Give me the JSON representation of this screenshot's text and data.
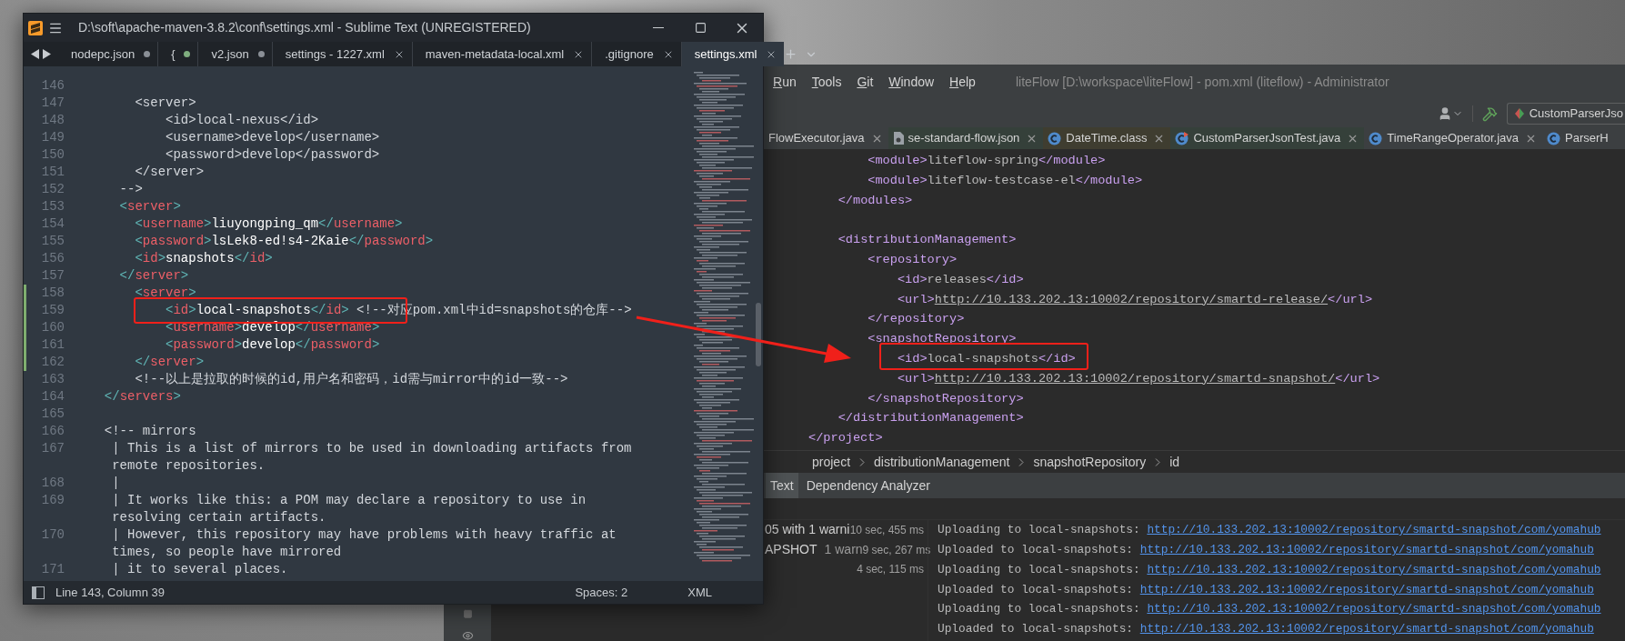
{
  "sublime": {
    "title": "D:\\soft\\apache-maven-3.8.2\\conf\\settings.xml - Sublime Text (UNREGISTERED)",
    "tabs": [
      {
        "label": "nodepc.json",
        "selected": false,
        "modified": true,
        "color": "#8a8f96"
      },
      {
        "label": "{",
        "selected": false,
        "modified": true,
        "color": "#7fae7f"
      },
      {
        "label": "v2.json",
        "selected": false,
        "modified": true,
        "color": "#8a8f96"
      },
      {
        "label": "settings - 1227.xml",
        "selected": false,
        "modified": false
      },
      {
        "label": "maven-metadata-local.xml",
        "selected": false,
        "modified": false
      },
      {
        "label": ".gitignore",
        "selected": false,
        "modified": false
      },
      {
        "label": "settings.xml",
        "selected": true,
        "modified": false
      }
    ],
    "lines": [
      {
        "number": "146",
        "kind": "comment",
        "changed": false
      },
      {
        "number": "147",
        "text": "      <server>",
        "kind": "comment",
        "changed": false
      },
      {
        "number": "148",
        "text": "          <id>local-nexus</id>",
        "kind": "comment",
        "changed": false
      },
      {
        "number": "149",
        "text": "          <username>develop</username>",
        "kind": "comment",
        "changed": false
      },
      {
        "number": "150",
        "text": "          <password>develop</password>",
        "kind": "comment",
        "changed": false
      },
      {
        "number": "151",
        "text": "      </server>",
        "kind": "comment",
        "changed": false
      },
      {
        "number": "152",
        "text": "    -->",
        "kind": "comment",
        "changed": false
      },
      {
        "number": "153",
        "text": "    <server>",
        "kind": "xml",
        "changed": false
      },
      {
        "number": "154",
        "text": "      <username>liuyongping_qm</username>",
        "kind": "xml",
        "changed": false
      },
      {
        "number": "155",
        "text": "      <password>lsLek8-ed!s4-2Kaie</password>",
        "kind": "xml",
        "changed": false
      },
      {
        "number": "156",
        "text": "      <id>snapshots</id>",
        "kind": "xml",
        "changed": false
      },
      {
        "number": "157",
        "text": "    </server>",
        "kind": "xml",
        "changed": false
      },
      {
        "number": "158",
        "text": "      <server>",
        "kind": "xml",
        "changed": true
      },
      {
        "number": "159",
        "text": "          <id>local-snapshots</id>",
        "comment": "<!--对应pom.xml中id=snapshots的仓库-->",
        "kind": "xml",
        "changed": true
      },
      {
        "number": "160",
        "text": "          <username>develop</username>",
        "kind": "xml",
        "changed": true
      },
      {
        "number": "161",
        "text": "          <password>develop</password>",
        "kind": "xml",
        "changed": true
      },
      {
        "number": "162",
        "text": "      </server>",
        "kind": "xml",
        "changed": true
      },
      {
        "number": "163",
        "text": "      <!--以上是拉取的时候的id,用户名和密码，id需与mirror中的id一致-->",
        "kind": "xml",
        "changed": false
      },
      {
        "number": "164",
        "text": "  </servers>",
        "kind": "xml",
        "changed": false
      },
      {
        "number": "165",
        "kind": "comment",
        "changed": false
      },
      {
        "number": "166",
        "text": "  <!-- mirrors",
        "kind": "comment",
        "changed": false
      },
      {
        "number": "167",
        "text": "   | This is a list of mirrors to be used in downloading artifacts from remote repositories.",
        "kind": "comment",
        "changed": false
      },
      {
        "number": "168",
        "text": "   |",
        "kind": "comment",
        "changed": false
      },
      {
        "number": "169",
        "text": "   | It works like this: a POM may declare a repository to use in resolving certain artifacts.",
        "kind": "comment",
        "changed": false
      },
      {
        "number": "170",
        "text": "   | However, this repository may have problems with heavy traffic at times, so people have mirrored",
        "kind": "comment",
        "changed": false
      },
      {
        "number": "171",
        "text": "   | it to several places.",
        "kind": "comment",
        "changed": false
      }
    ],
    "status": {
      "position": "Line 143, Column 39",
      "indentation": "Spaces: 2",
      "syntax": "XML"
    }
  },
  "ide": {
    "menu": [
      "Run",
      "Tools",
      "Git",
      "Window",
      "Help"
    ],
    "title": "liteFlow [D:\\workspace\\liteFlow] - pom.xml (liteflow) - Administrator",
    "run_config": "CustomParserJso",
    "tabs": [
      {
        "label": "FlowExecutor.java",
        "kind": "plain",
        "color": "#3c3f41"
      },
      {
        "label": "se-standard-flow.json",
        "kind": "json",
        "color": "#35403a"
      },
      {
        "label": "DateTime.class",
        "kind": "class",
        "color": "#3f3d30"
      },
      {
        "label": "CustomParserJsonTest.java",
        "kind": "test",
        "color": "#35403a"
      },
      {
        "label": "TimeRangeOperator.java",
        "kind": "class",
        "color": "#3c3f41"
      },
      {
        "label": "ParserH",
        "kind": "class",
        "color": "#3c3f41"
      }
    ],
    "code": [
      {
        "text": "        <module>liteflow-spring</module>"
      },
      {
        "text": "        <module>liteflow-testcase-el</module>"
      },
      {
        "text": "    </modules>"
      },
      {
        "text": "    <distributionManagement>",
        "blank_before": true
      },
      {
        "text": "        <repository>"
      },
      {
        "text": "            <id>releases</id>"
      },
      {
        "text": "            <url>http://10.133.202.13:10002/repository/smartd-release/</url>",
        "link": true
      },
      {
        "text": "        </repository>"
      },
      {
        "text": "        <snapshotRepository>"
      },
      {
        "text": "            <id>local-snapshots</id>"
      },
      {
        "text": "            <url>http://10.133.202.13:10002/repository/smartd-snapshot/</url>",
        "link": true
      },
      {
        "text": "        </snapshotRepository>"
      },
      {
        "text": "    </distributionManagement>"
      },
      {
        "text": "</project>"
      }
    ],
    "breadcrumbs": [
      "project",
      "distributionManagement",
      "snapshotRepository",
      "id"
    ],
    "tool_tabs": [
      {
        "label": "Text",
        "selected": true
      },
      {
        "label": "Dependency Analyzer",
        "selected": false
      }
    ],
    "build_tree": [
      {
        "label": "05 with 1 warni",
        "time": "10 sec, 455 ms"
      },
      {
        "label": "APSHOT",
        "note": "1 warn",
        "time": "9 sec, 267 ms"
      },
      {
        "time": "4 sec, 115 ms"
      }
    ],
    "console": [
      {
        "message": "Uploading to local-snapshots:",
        "url": "http://10.133.202.13:10002/repository/smartd-snapshot/com/yomahub"
      },
      {
        "message": "Uploaded to local-snapshots:",
        "url": "http://10.133.202.13:10002/repository/smartd-snapshot/com/yomahub"
      },
      {
        "message": "Uploading to local-snapshots:",
        "url": "http://10.133.202.13:10002/repository/smartd-snapshot/com/yomahub"
      },
      {
        "message": "Uploaded to local-snapshots:",
        "url": "http://10.133.202.13:10002/repository/smartd-snapshot/com/yomahub"
      },
      {
        "message": "Uploading to local-snapshots:",
        "url": "http://10.133.202.13:10002/repository/smartd-snapshot/com/yomahub"
      },
      {
        "message": "Uploaded to local-snapshots:",
        "url": "http://10.133.202.13:10002/repository/smartd-snapshot/com/yomahub"
      }
    ]
  }
}
